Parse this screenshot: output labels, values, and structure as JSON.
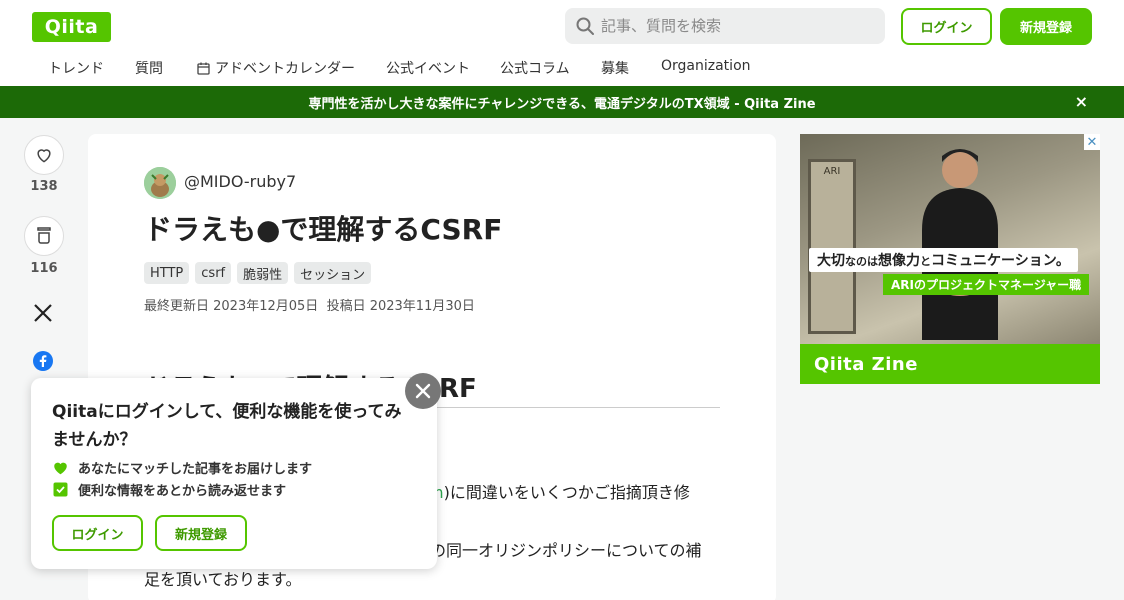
{
  "header": {
    "logo": "Qiita",
    "search_placeholder": "記事、質問を検索",
    "login_label": "ログイン",
    "signup_label": "新規登録",
    "nav": [
      "トレンド",
      "質問",
      "アドベントカレンダー",
      "公式イベント",
      "公式コラム",
      "募集",
      "Organization"
    ]
  },
  "banner": {
    "text": "専門性を活かし大きな案件にチャレンジできる、電通デジタルのTX領域 - Qiita Zine",
    "close": "×"
  },
  "actions": {
    "like_count": "138",
    "stock_count": "116"
  },
  "article": {
    "author": "@MIDO-ruby7",
    "title": "ドラえも●で理解するCSRF",
    "tags": [
      "HTTP",
      "csrf",
      "脆弱性",
      "セッション"
    ],
    "updated": "最終更新日 2023年12月05日",
    "posted": "投稿日 2023年11月30日",
    "heading": "ドラえも●で理解するCSRF",
    "para1_link": "m",
    "para1_text": ")に間違いをいくつかご指摘頂き修",
    "para2_text": "の同一オリジンポリシーについての補",
    "para3_text": "足を頂いております。"
  },
  "ad": {
    "headline_big1": "大切",
    "headline_small1": "なのは",
    "headline_big2": "想像力",
    "headline_small2": "と",
    "headline_big3": "コミュニケーション。",
    "sub": "ARIのプロジェクトマネージャー職",
    "footer": "Qiita Zine",
    "corner": "✕",
    "window_sign": "ARI"
  },
  "popup": {
    "title": "Qiitaにログインして、便利な機能を使ってみませんか？",
    "features": [
      "あなたにマッチした記事をお届けします",
      "便利な情報をあとから読み返せます"
    ],
    "login_label": "ログイン",
    "signup_label": "新規登録"
  },
  "colors": {
    "brand": "#55c500",
    "banner": "#1c6a07"
  }
}
